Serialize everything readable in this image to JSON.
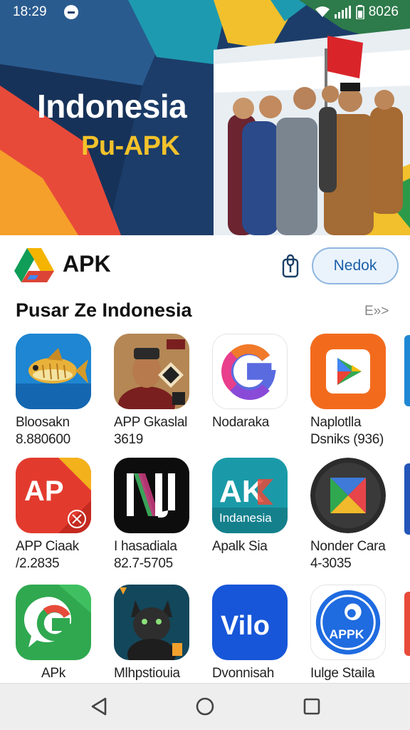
{
  "status_bar": {
    "time": "18:29",
    "clock_right": "8026"
  },
  "hero": {
    "title": "Indonesia",
    "subtitle": "Pu-APK"
  },
  "app_header": {
    "name": "APK",
    "action_button": "Nedok"
  },
  "section": {
    "title": "Pusar Ze Indonesia",
    "more_label": "E»>"
  },
  "apps": [
    {
      "name": "Bloosakn",
      "meta": "8.880600",
      "icon": "fish-icon",
      "color": "#1f88d4"
    },
    {
      "name": "APP Gkaslal",
      "meta": "3619",
      "icon": "portrait-icon",
      "color": "#7a4a1c"
    },
    {
      "name": "Nodaraka",
      "meta": "",
      "icon": "google-g-icon",
      "color": "#ffffff"
    },
    {
      "name": "Naplotlla",
      "meta": "Dsniks (936)",
      "icon": "play-store-icon",
      "color": "#f26a1b"
    },
    {
      "name": "APP Ciaak",
      "meta": "/2.2835",
      "icon": "ap-logo-icon",
      "color": "#e23b2e"
    },
    {
      "name": "I hasadiala",
      "meta": "82.7-5705",
      "icon": "nj-logo-icon",
      "color": "#111111"
    },
    {
      "name": "Apalk Sia",
      "meta": "",
      "icon": "ak-logo-icon",
      "color": "#1a9aa8"
    },
    {
      "name": "Nonder Cara",
      "meta": "4-3035",
      "icon": "prism-icon",
      "color": "#2b2b2b"
    },
    {
      "name": "APk",
      "meta": "",
      "icon": "chat-g-icon",
      "color": "#2fa84f"
    },
    {
      "name": "Mlhpstiouia",
      "meta": "",
      "icon": "cat-portrait-icon",
      "color": "#17324a"
    },
    {
      "name": "Dvonnisah",
      "meta": "",
      "icon": "vilo-logo-icon",
      "color": "#1756d8"
    },
    {
      "name": "Iulge Staila",
      "meta": "",
      "icon": "appk-circle-icon",
      "color": "#1f6be0"
    }
  ],
  "apps_icon_text": {
    "ap": "AP",
    "nj": "NJ",
    "ak": "AK",
    "ak_sub": "Indanesia",
    "vilo": "Vilo",
    "appk": "APPK"
  },
  "navigation": [
    "back-icon",
    "home-icon",
    "recents-icon"
  ]
}
